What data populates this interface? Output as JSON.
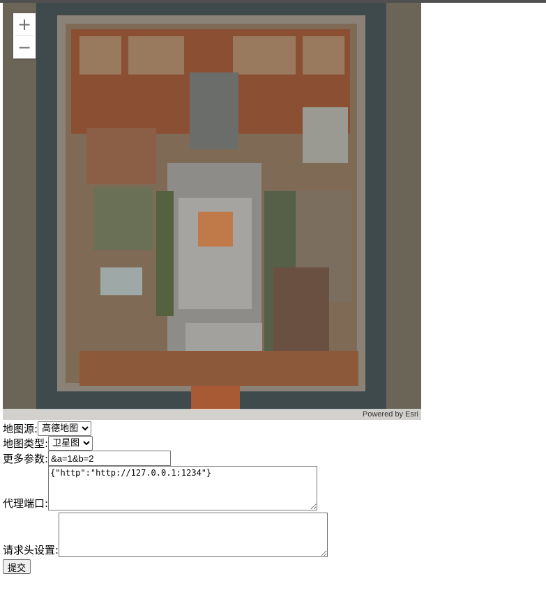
{
  "map": {
    "zoom_in_icon": "plus-icon",
    "zoom_out_icon": "minus-icon",
    "zoom_in_symbol": "+",
    "zoom_out_symbol": "−",
    "attribution": "Powered by Esri"
  },
  "form": {
    "source_label": "地图源:",
    "source_value": "高德地图",
    "type_label": "地图类型:",
    "type_value": "卫星图",
    "params_label": "更多参数:",
    "params_value": "&a=1&b=2",
    "proxy_label": "代理端口:",
    "proxy_value": "{\"http\":\"http://127.0.0.1:1234\"}",
    "headers_label": "请求头设置:",
    "headers_value": "",
    "submit_label": "提交"
  }
}
